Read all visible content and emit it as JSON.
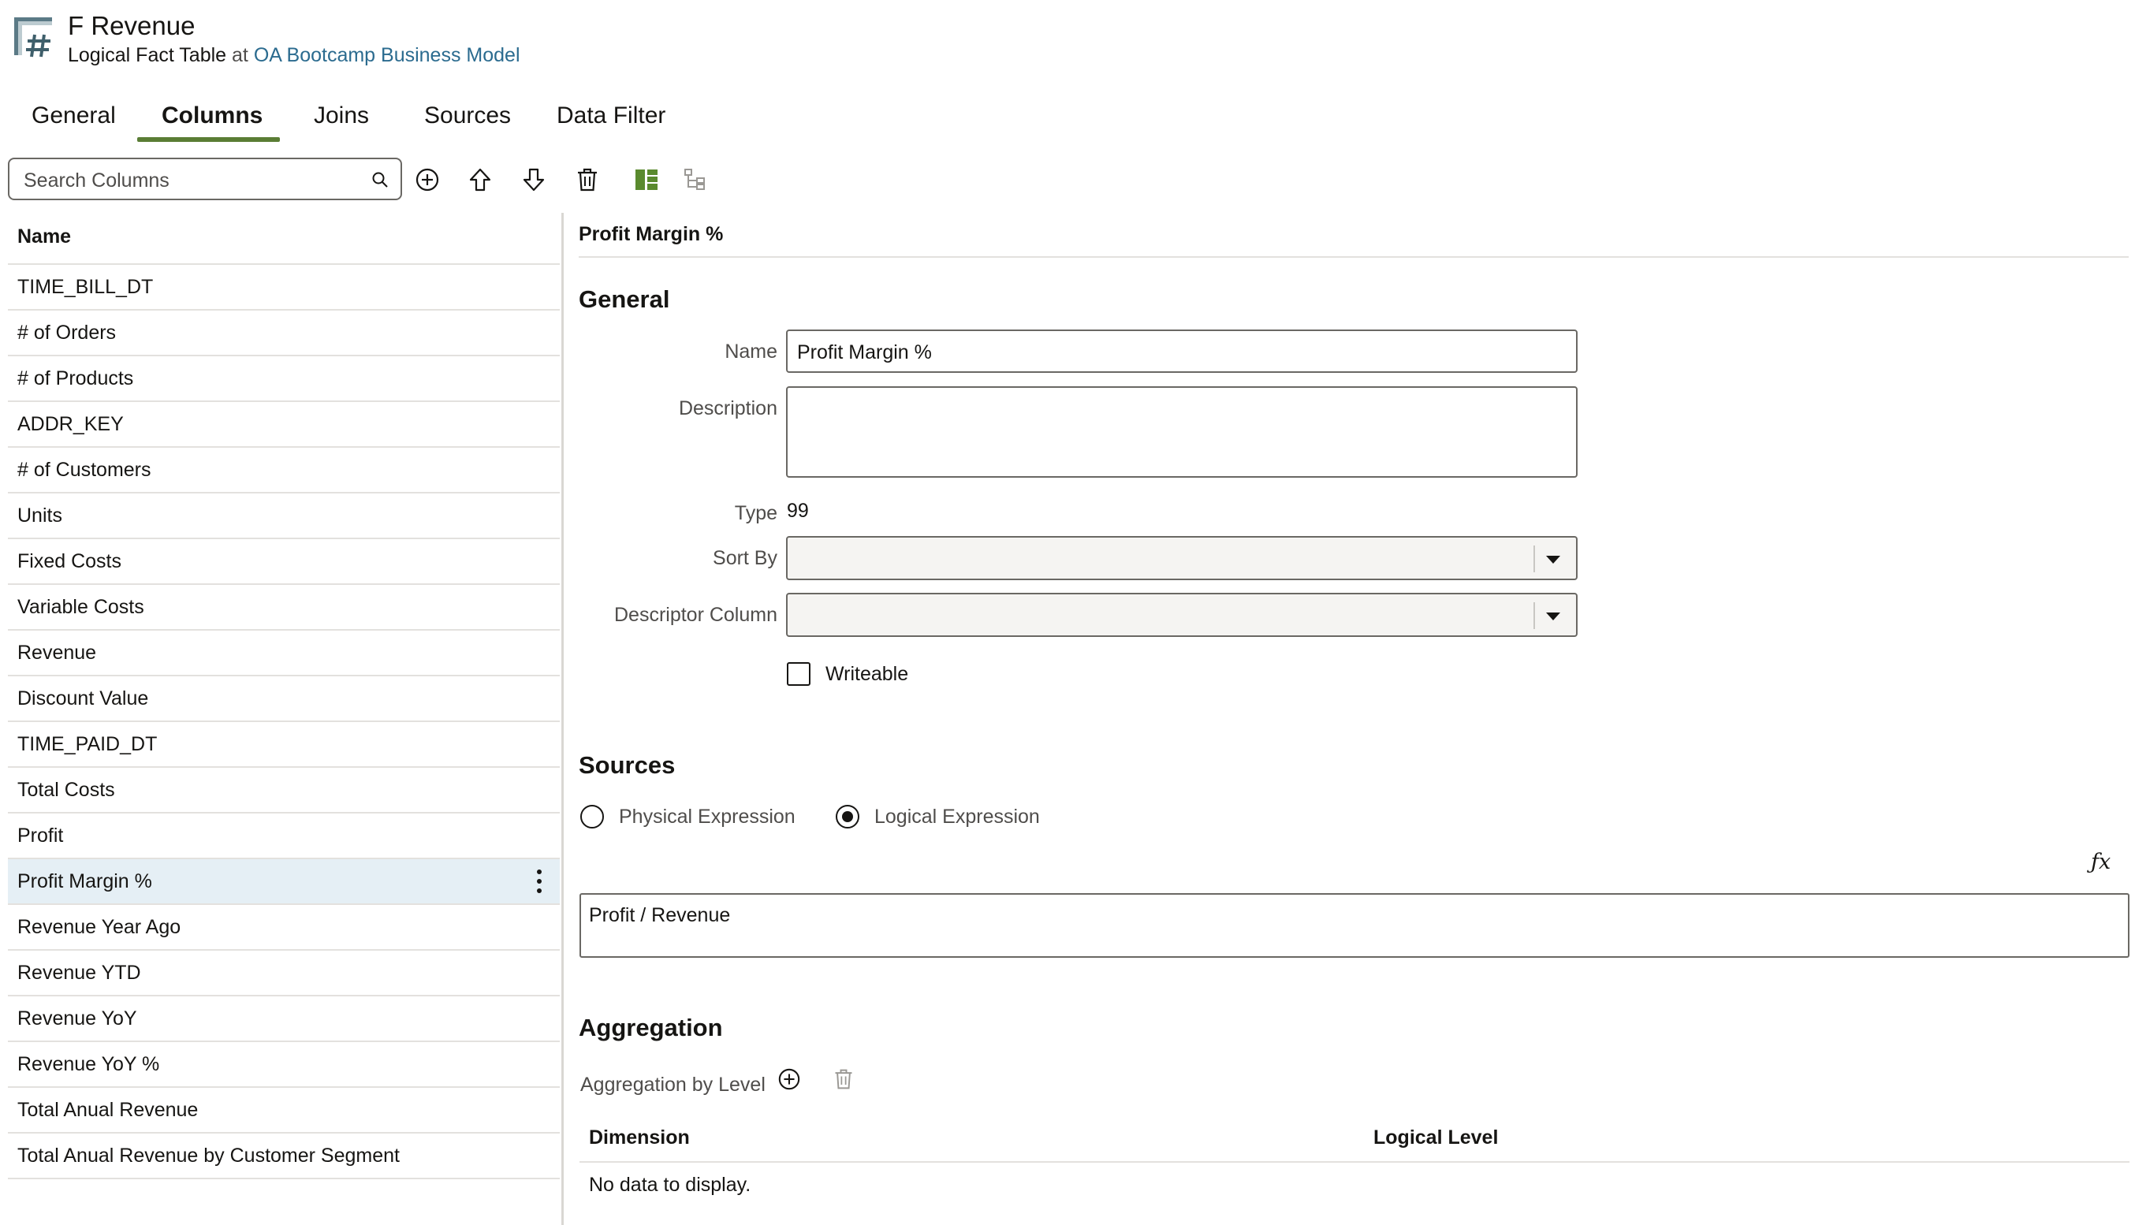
{
  "header": {
    "title": "F Revenue",
    "subtitle_type": "Logical Fact Table",
    "subtitle_at": "at",
    "subtitle_model": "OA Bootcamp Business Model",
    "icon": "logical-fact-table-icon"
  },
  "tabs": [
    {
      "label": "General",
      "active": false
    },
    {
      "label": "Columns",
      "active": true
    },
    {
      "label": "Joins",
      "active": false
    },
    {
      "label": "Sources",
      "active": false
    },
    {
      "label": "Data Filter",
      "active": false
    }
  ],
  "search": {
    "placeholder": "Search Columns",
    "value": ""
  },
  "toolbar_icons": [
    "add-circle-icon",
    "move-up-icon",
    "move-down-icon",
    "delete-icon",
    "column-layout-icon",
    "hierarchy-icon"
  ],
  "list": {
    "header": "Name",
    "selected_index": 13,
    "items": [
      "TIME_BILL_DT",
      "# of Orders",
      "# of Products",
      "ADDR_KEY",
      "# of Customers",
      "Units",
      "Fixed Costs",
      "Variable Costs",
      "Revenue",
      "Discount Value",
      "TIME_PAID_DT",
      "Total Costs",
      "Profit",
      "Profit Margin %",
      "Revenue Year Ago",
      "Revenue YTD",
      "Revenue YoY",
      "Revenue YoY %",
      "Total Anual Revenue",
      "Total Anual Revenue by Customer Segment"
    ]
  },
  "detail": {
    "title": "Profit Margin %",
    "general": {
      "heading": "General",
      "name_label": "Name",
      "name_value": "Profit Margin %",
      "description_label": "Description",
      "description_value": "",
      "type_label": "Type",
      "type_value": "99",
      "sort_by_label": "Sort By",
      "sort_by_value": "",
      "descriptor_label": "Descriptor Column",
      "descriptor_value": "",
      "writeable_label": "Writeable",
      "writeable_checked": false
    },
    "sources": {
      "heading": "Sources",
      "physical_label": "Physical Expression",
      "logical_label": "Logical Expression",
      "selected": "logical",
      "fx_label": "ƒx",
      "expression": "Profit  / Revenue"
    },
    "aggregation": {
      "heading": "Aggregation",
      "by_level_label": "Aggregation by Level",
      "col_dimension": "Dimension",
      "col_logical_level": "Logical Level",
      "empty_text": "No data to display."
    }
  },
  "colors": {
    "accent_underline": "#5a7d35",
    "selected_row": "#e5eff5",
    "link": "#2b6b8f",
    "layout_icon": "#5a8a2e"
  }
}
